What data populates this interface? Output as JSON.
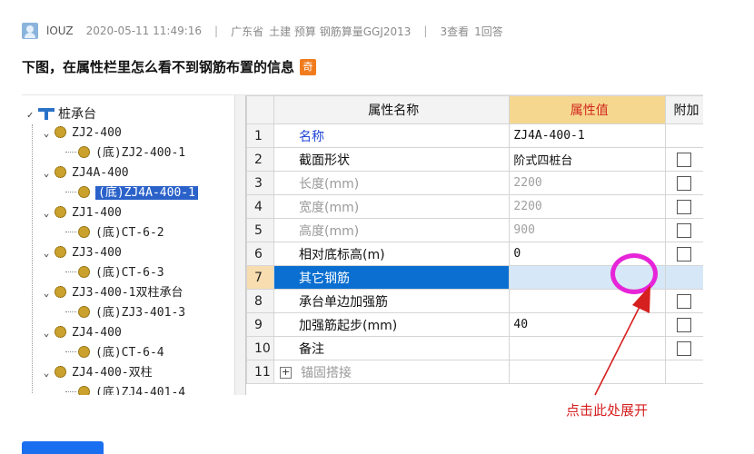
{
  "post": {
    "username": "lOUZ",
    "datetime": "2020-05-11 11:49:16",
    "separator": "|",
    "location": "广东省",
    "tags": "土建 预算 钢筋算量GGJ2013",
    "views": "3查看",
    "answers": "1回答",
    "title": "下图，在属性栏里怎么看不到钢筋布置的信息",
    "badge": "奇"
  },
  "tree": {
    "root": "桩承台",
    "items": [
      {
        "label": "ZJ2-400",
        "type": "group"
      },
      {
        "label": "(底)ZJ2-400-1",
        "type": "leaf"
      },
      {
        "label": "ZJ4A-400",
        "type": "group"
      },
      {
        "label": "(底)ZJ4A-400-1",
        "type": "leaf",
        "selected": true
      },
      {
        "label": "ZJ1-400",
        "type": "group"
      },
      {
        "label": "(底)CT-6-2",
        "type": "leaf"
      },
      {
        "label": "ZJ3-400",
        "type": "group"
      },
      {
        "label": "(底)CT-6-3",
        "type": "leaf"
      },
      {
        "label": "ZJ3-400-1双柱承台",
        "type": "group"
      },
      {
        "label": "(底)ZJ3-401-3",
        "type": "leaf"
      },
      {
        "label": "ZJ4-400",
        "type": "group"
      },
      {
        "label": "(底)CT-6-4",
        "type": "leaf"
      },
      {
        "label": "ZJ4-400-双柱",
        "type": "group"
      },
      {
        "label": "(底)ZJ4-401-4",
        "type": "leaf"
      }
    ]
  },
  "grid": {
    "headers": {
      "name": "属性名称",
      "value": "属性值",
      "extra": "附加"
    },
    "rows": [
      {
        "num": "1",
        "name": "名称",
        "value": "ZJ4A-400-1",
        "style": "link",
        "checkbox": false
      },
      {
        "num": "2",
        "name": "截面形状",
        "value": "阶式四桩台",
        "style": "normal",
        "checkbox": true
      },
      {
        "num": "3",
        "name": "长度(mm)",
        "value": "2200",
        "style": "gray",
        "checkbox": true
      },
      {
        "num": "4",
        "name": "宽度(mm)",
        "value": "2200",
        "style": "gray",
        "checkbox": true
      },
      {
        "num": "5",
        "name": "高度(mm)",
        "value": "900",
        "style": "gray",
        "checkbox": true
      },
      {
        "num": "6",
        "name": "相对底标高(m)",
        "value": "0",
        "style": "normal",
        "checkbox": true
      },
      {
        "num": "7",
        "name": "其它钢筋",
        "value": "",
        "style": "selected",
        "checkbox": false
      },
      {
        "num": "8",
        "name": "承台单边加强筋",
        "value": "",
        "style": "normal",
        "checkbox": true
      },
      {
        "num": "9",
        "name": "加强筋起步(mm)",
        "value": "40",
        "style": "normal",
        "checkbox": true
      },
      {
        "num": "10",
        "name": "备注",
        "value": "",
        "style": "normal",
        "checkbox": true
      },
      {
        "num": "11",
        "name": "锚固搭接",
        "value": "",
        "style": "expand",
        "expand_symbol": "+",
        "checkbox": false
      }
    ]
  },
  "annotation": {
    "text": "点击此处展开",
    "color": "#d61f1f",
    "circle_color": "#e625d8"
  },
  "colors": {
    "selection_blue": "#0a6fd0",
    "header_value_bg": "#f6d78f",
    "header_value_text": "#d0281f",
    "tag_orange": "#f07c1e"
  }
}
